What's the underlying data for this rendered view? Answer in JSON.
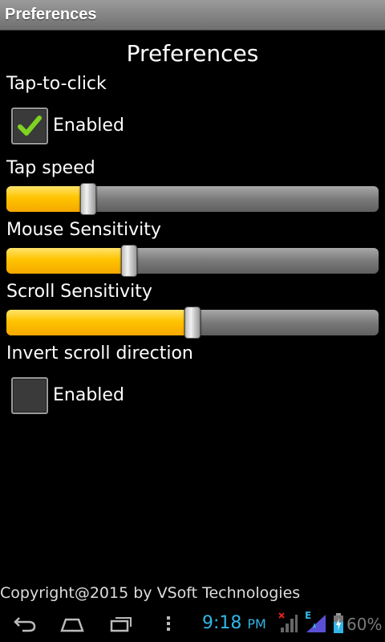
{
  "window": {
    "title": "Preferences"
  },
  "page": {
    "heading": "Preferences"
  },
  "tap_to_click": {
    "label": "Tap-to-click",
    "checkbox_label": "Enabled",
    "checked": true
  },
  "tap_speed": {
    "label": "Tap speed",
    "value_fraction": 0.22
  },
  "mouse_sensitivity": {
    "label": "Mouse Sensitivity",
    "value_fraction": 0.33
  },
  "scroll_sensitivity": {
    "label": "Scroll Sensitivity",
    "value_fraction": 0.5
  },
  "invert_scroll": {
    "label": "Invert scroll direction",
    "checkbox_label": "Enabled",
    "checked": false
  },
  "footer": {
    "copyright": "Copyright@2015 by VSoft Technologies"
  },
  "system_bar": {
    "time": "9:18",
    "ampm": "PM",
    "network_type": "E",
    "battery_percent": "60%",
    "icons": [
      "back-icon",
      "home-icon",
      "recent-apps-icon",
      "menu-icon",
      "no-signal-icon",
      "signal-icon",
      "battery-charging-icon"
    ],
    "accent_color": "#33b5e5"
  },
  "colors": {
    "slider_fill": "#ffc400",
    "check_mark": "#7ed321"
  }
}
